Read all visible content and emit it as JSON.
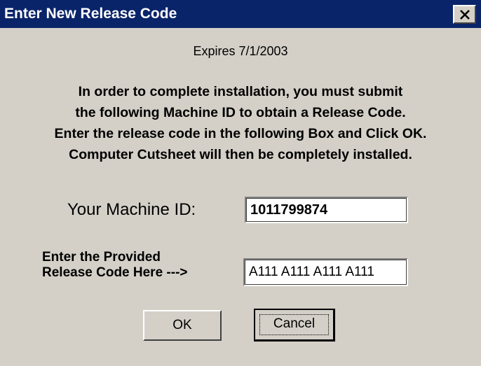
{
  "window": {
    "title": "Enter New Release Code",
    "close_icon": "close-icon"
  },
  "expires": "Expires 7/1/2003",
  "instructions": [
    "In order to complete installation, you must submit",
    "the following Machine ID to obtain a Release Code.",
    "Enter the release code in the following Box and Click OK.",
    "Computer Cutsheet will then be completely installed."
  ],
  "machine_id": {
    "label": "Your Machine ID:",
    "value": "1011799874"
  },
  "release_code": {
    "label_line1": "Enter the Provided",
    "label_line2": "Release Code Here --->",
    "value": "A111 A111 A111 A111"
  },
  "buttons": {
    "ok": "OK",
    "cancel": "Cancel"
  },
  "colors": {
    "titlebar": "#0a246a",
    "face": "#d4d0c8"
  }
}
